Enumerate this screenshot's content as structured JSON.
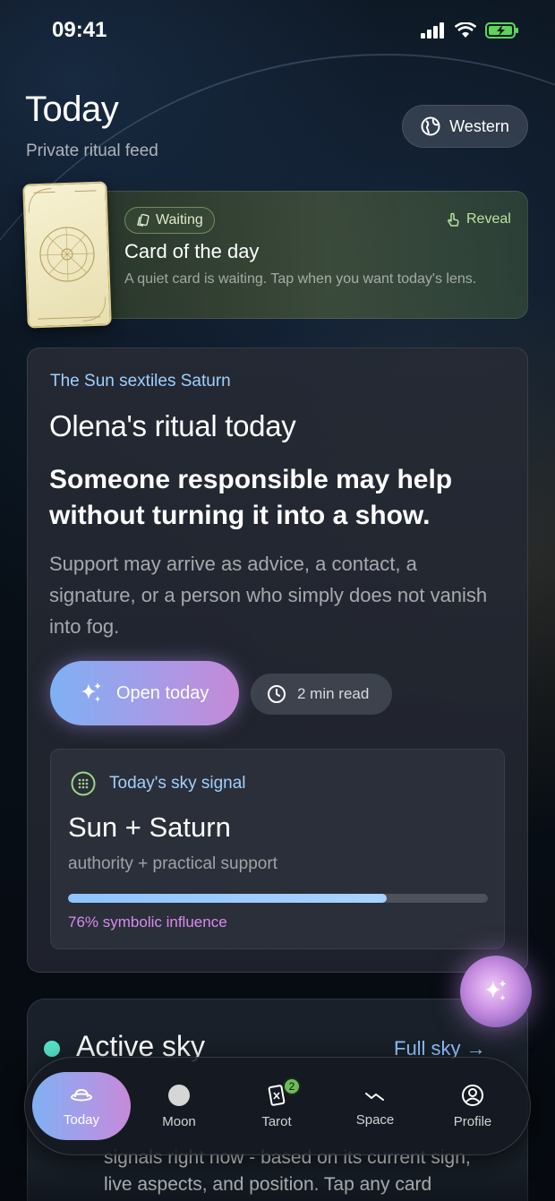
{
  "status_bar": {
    "time": "09:41"
  },
  "header": {
    "title": "Today",
    "subtitle": "Private ritual feed",
    "tradition_label": "Western"
  },
  "card_of_day": {
    "badge": "Waiting",
    "action": "Reveal",
    "title": "Card of the day",
    "description": "A quiet card is waiting. Tap when you want today's lens."
  },
  "ritual": {
    "transit": "The Sun sextiles Saturn",
    "title": "Olena's ritual today",
    "headline": "Someone responsible may help without turning it into a show.",
    "body": "Support may arrive as advice, a contact, a signature, or a person who simply does not vanish into fog.",
    "open_label": "Open today",
    "read_time": "2 min read",
    "signal": {
      "label": "Today's sky signal",
      "title": "Sun + Saturn",
      "subtitle": "authority + practical support",
      "influence_percent": 76,
      "influence_label": "76% symbolic influence"
    }
  },
  "active_sky": {
    "title": "Active sky",
    "link": "Full sky →",
    "body": "signals right now - based on its current sign, live aspects, and position. Tap any card"
  },
  "tabs": [
    {
      "label": "Today",
      "icon": "planet-icon",
      "active": true
    },
    {
      "label": "Moon",
      "icon": "moon-icon"
    },
    {
      "label": "Tarot",
      "icon": "tarot-card-icon",
      "badge": "2"
    },
    {
      "label": "Space",
      "icon": "trend-icon"
    },
    {
      "label": "Profile",
      "icon": "profile-icon"
    }
  ],
  "colors": {
    "accent_blue": "#9fd0ff",
    "accent_violet": "#c589d6",
    "accent_green": "#b8e49e",
    "active_dot": "#55e0c6",
    "influence_text": "#d88bef"
  }
}
